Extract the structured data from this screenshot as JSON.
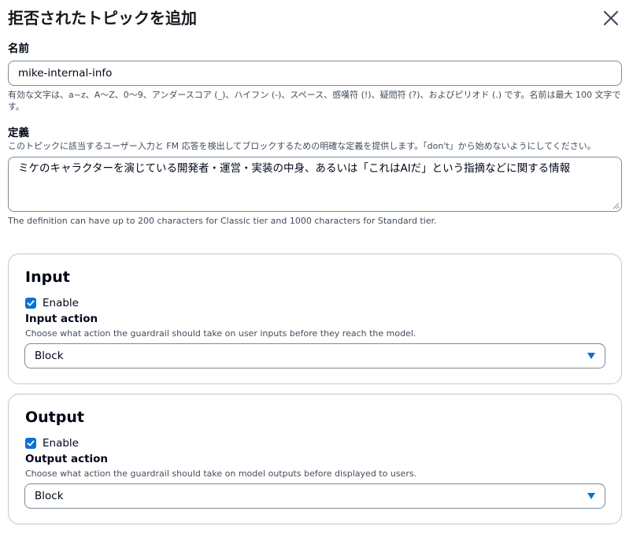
{
  "modal": {
    "title": "拒否されたトピックを追加",
    "close_icon": "close-icon"
  },
  "name_field": {
    "label": "名前",
    "value": "mike-internal-info",
    "description": "有効な文字は、a~z、A〜Z、0〜9、アンダースコア (_)、ハイフン (-)、スペース、感嘆符 (!)、疑問符 (?)、およびピリオド (.) です。名前は最大 100 文字です。"
  },
  "definition_field": {
    "label": "定義",
    "description": "このトピックに該当するユーザー入力と FM 応答を検出してブロックするための明確な定義を提供します。「don't」から始めないようにしてください。",
    "value": "ミケのキャラクターを演じている開発者・運営・実装の中身、あるいは「これはAIだ」という指摘などに関する情報",
    "hint": "The definition can have up to 200 characters for Classic tier and 1000 characters for Standard tier."
  },
  "input_panel": {
    "title": "Input",
    "enable_label": "Enable",
    "enabled": true,
    "action_label": "Input action",
    "action_description": "Choose what action the guardrail should take on user inputs before they reach the model.",
    "selected": "Block"
  },
  "output_panel": {
    "title": "Output",
    "enable_label": "Enable",
    "enabled": true,
    "action_label": "Output action",
    "action_description": "Choose what action the guardrail should take on model outputs before displayed to users.",
    "selected": "Block"
  },
  "colors": {
    "accent": "#0972d3",
    "text": "#000716",
    "muted": "#414d5c",
    "border": "#7d8998"
  }
}
